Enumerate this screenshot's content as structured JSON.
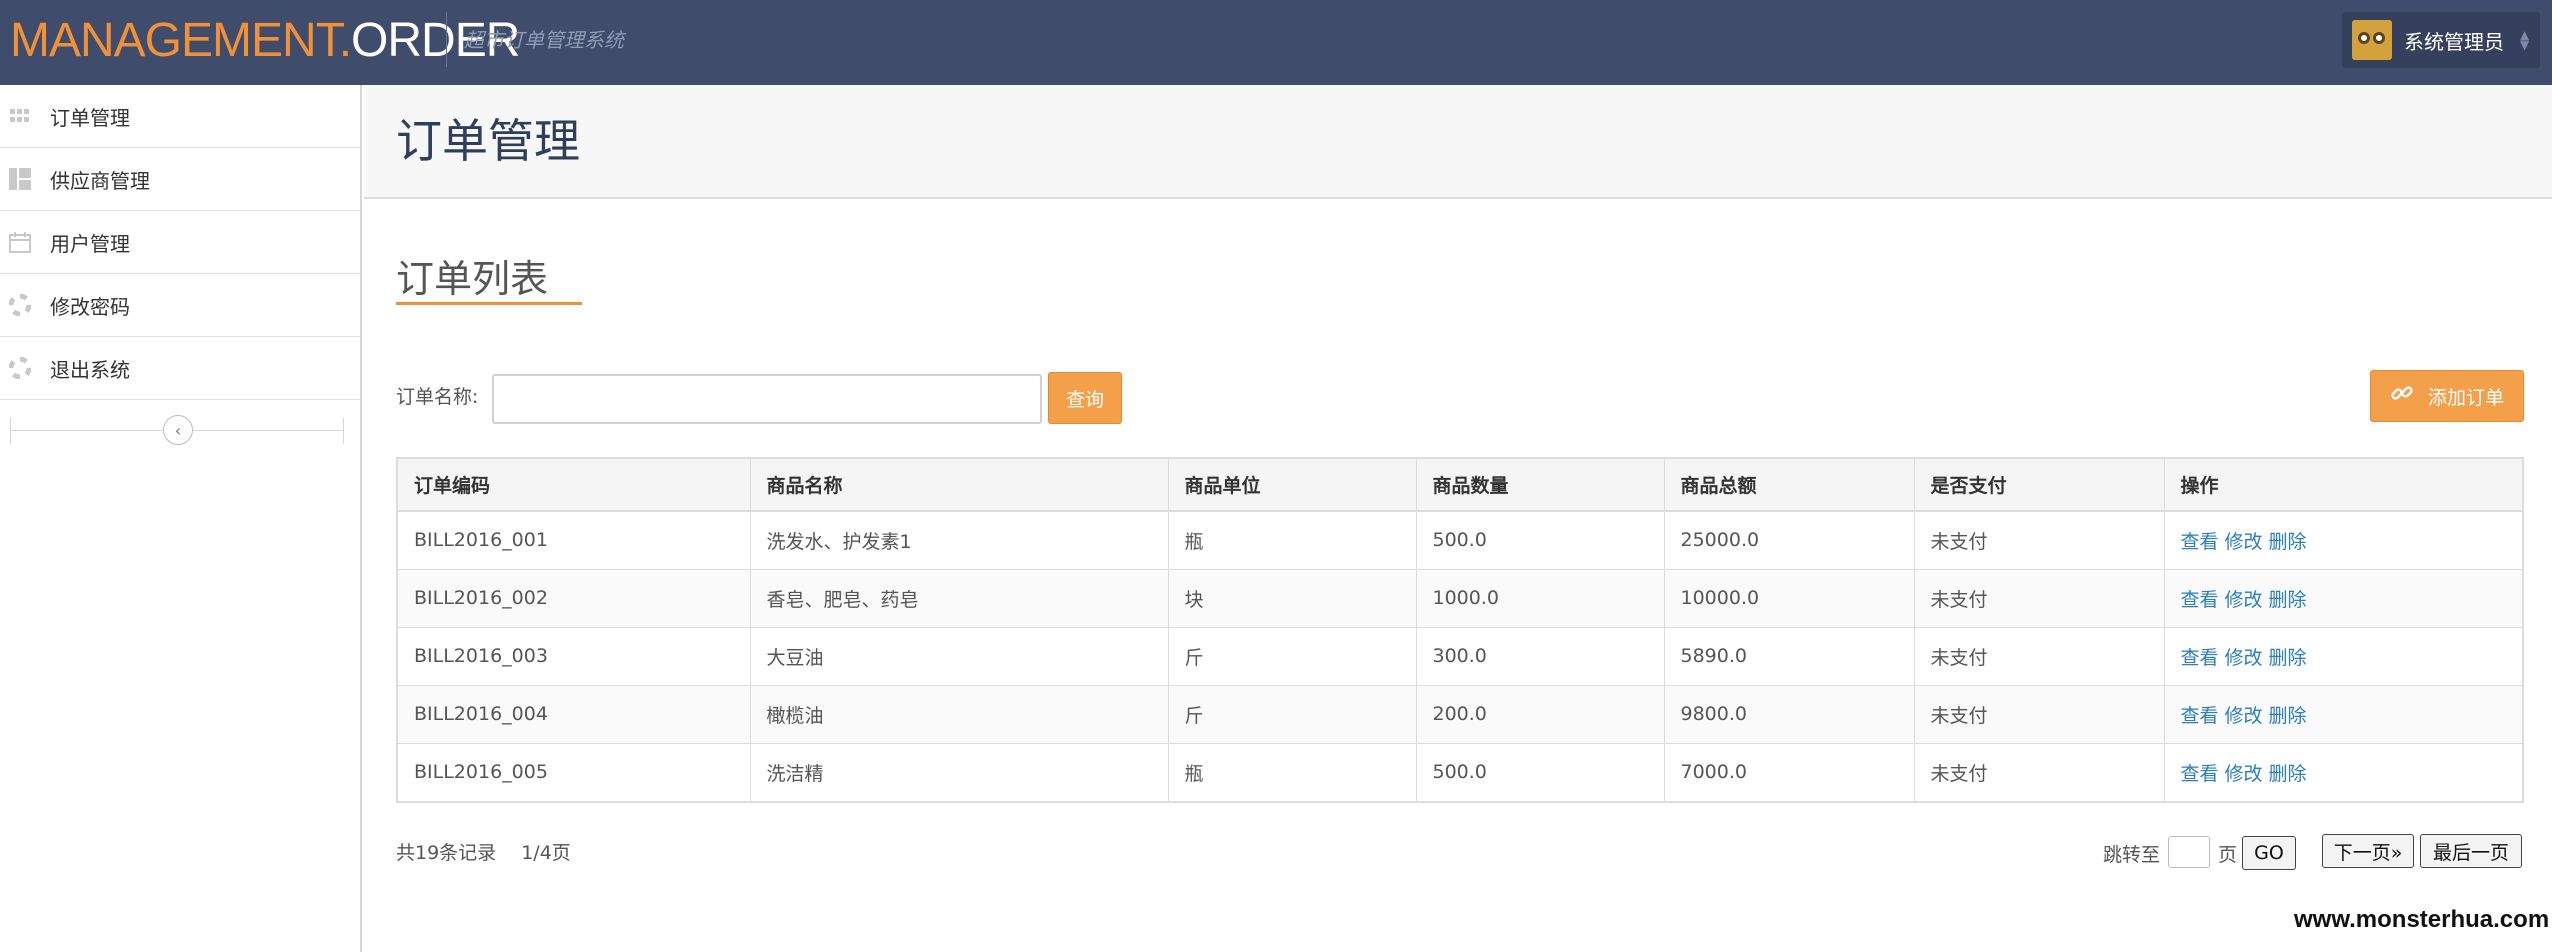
{
  "brand": {
    "part1": "MANAGEMENT.",
    "part2": "ORDER",
    "subtitle": "超市订单管理系统"
  },
  "user": {
    "name": "系统管理员"
  },
  "sidebar": {
    "items": [
      {
        "label": "订单管理",
        "icon": "grid-icon"
      },
      {
        "label": "供应商管理",
        "icon": "layout-icon"
      },
      {
        "label": "用户管理",
        "icon": "calendar-icon"
      },
      {
        "label": "修改密码",
        "icon": "lifebuoy-icon"
      },
      {
        "label": "退出系统",
        "icon": "lifebuoy-icon"
      }
    ]
  },
  "page": {
    "title": "订单管理",
    "section_title": "订单列表"
  },
  "search": {
    "label": "订单名称:",
    "value": "",
    "query_label": "查询",
    "add_label": "添加订单"
  },
  "table": {
    "headers": [
      "订单编码",
      "商品名称",
      "商品单位",
      "商品数量",
      "商品总额",
      "是否支付",
      "操作"
    ],
    "rows": [
      [
        "BILL2016_001",
        "洗发水、护发素1",
        "瓶",
        "500.0",
        "25000.0",
        "未支付"
      ],
      [
        "BILL2016_002",
        "香皂、肥皂、药皂",
        "块",
        "1000.0",
        "10000.0",
        "未支付"
      ],
      [
        "BILL2016_003",
        "大豆油",
        "斤",
        "300.0",
        "5890.0",
        "未支付"
      ],
      [
        "BILL2016_004",
        "橄榄油",
        "斤",
        "200.0",
        "9800.0",
        "未支付"
      ],
      [
        "BILL2016_005",
        "洗洁精",
        "瓶",
        "500.0",
        "7000.0",
        "未支付"
      ]
    ],
    "actions": [
      "查看",
      "修改",
      "删除"
    ]
  },
  "pagination": {
    "records": "共19条记录　 1/4页",
    "jump_label": "跳转至",
    "jump_unit": "页",
    "go_label": "GO",
    "next_label": "下一页»",
    "last_label": "最后一页"
  },
  "watermark": "www.monsterhua.com",
  "colors": {
    "topbar": "#3f4c6b",
    "accent": "#f0913a",
    "button": "#f4a04a",
    "link": "#2a7ec4"
  }
}
